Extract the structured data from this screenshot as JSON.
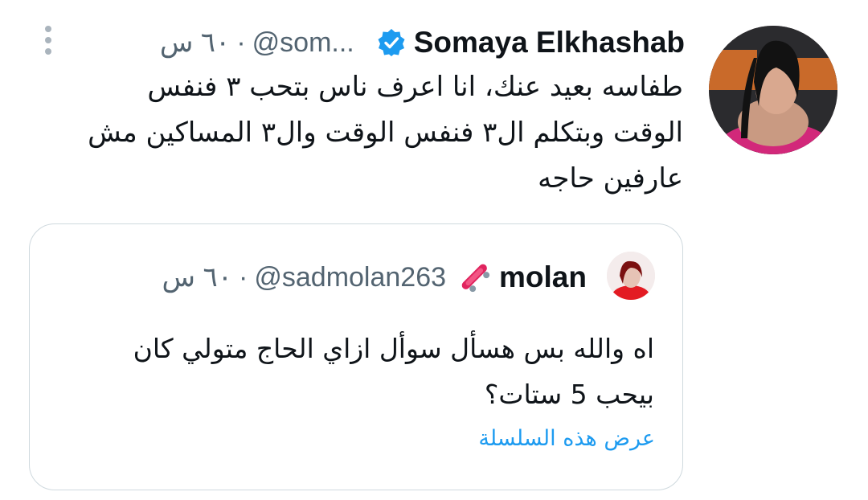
{
  "tweet": {
    "author_name": "Somaya Elkhashab",
    "handle": "@som...",
    "time": "٦٠ س",
    "text": "طفاسه بعيد عنك، انا اعرف ناس بتحب ٣ فنفس الوقت وبتكلم ال٣ فنفس الوقت وال٣ المساكين مش عارفين حاجه",
    "avatar_icon": "user-avatar",
    "verified_icon": "verified-badge-icon",
    "more_icon": "more-vertical-icon"
  },
  "quoted": {
    "author_name": "molan",
    "handle": "@sadmolan263",
    "time": "٦٠ س",
    "emoji_icon": "skateboard-icon",
    "text": "اه والله بس هسأل سوأل ازاي الحاج متولي كان بيحب 5 ستات؟",
    "show_thread": "عرض هذه السلسلة"
  },
  "colors": {
    "link": "#1d9bf0",
    "muted": "#536471",
    "border": "#cfd9de",
    "verified": "#1d9bf0"
  }
}
